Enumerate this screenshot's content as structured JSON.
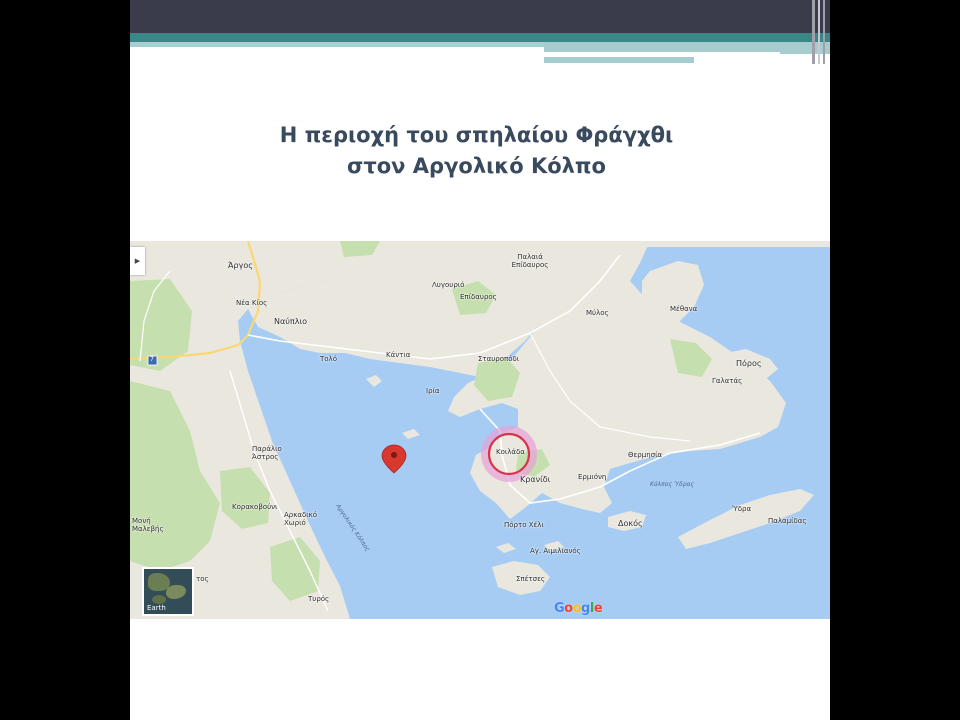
{
  "slide": {
    "title_line1": "Η περιοχή του σπηλαίου Φράγχθι",
    "title_line2": "στον Αργολικό Κόλπο"
  },
  "map": {
    "colors": {
      "water": "#a7ccf4",
      "land": "#eae7df",
      "green": "#c6dfae",
      "highlight_ring": "#d8324a",
      "highlight_glow": "#e7a0d8",
      "marker": "#d9382e"
    },
    "places": {
      "argos": "Άργος",
      "nea_kios": "Νέα Κίος",
      "nafplio": "Ναύπλιο",
      "tolo": "Τολό",
      "kantia": "Κάντια",
      "iria": "Ιρία",
      "paralio_astros": "Παράλιο Άστρος",
      "korakovouni": "Κορακοβούνι",
      "arkadiko_chorio": "Αρκαδικό Χωριό",
      "moni_malevis": "Μονή Μαλεβής",
      "tyros": "Τυρός",
      "ligourio": "Λυγουριό",
      "palaia_epidavros": "Παλαιά Επίδαυρος",
      "epidavros": "Επίδαυρος",
      "stavropodi": "Σταυροπόδι",
      "mylos": "Μύλος",
      "methana": "Μέθανα",
      "poros": "Πόρος",
      "galatas": "Γαλατάς",
      "koilada": "Κοιλάδα",
      "kranidi": "Κρανίδι",
      "ermioni": "Ερμιόνη",
      "thermisia": "Θερμησία",
      "porto_cheli": "Πόρτο Χέλι",
      "ag_aimilianos": "Αγ. Αιμιλιανός",
      "spetses": "Σπέτσες",
      "dokos": "Δοκός",
      "ydra": "Ύδρα",
      "palamidas": "Παλαμίδας",
      "argolikos_kolpos": "Αργολικός Κόλπος",
      "kolpos_ydras": "Κόλπος Ύδρας",
      "astros_short": "τος"
    },
    "earth_button": {
      "label": "Earth"
    },
    "google_logo": [
      "G",
      "o",
      "o",
      "g",
      "l",
      "e"
    ],
    "google_logo_colors": [
      "#4285f4",
      "#ea4335",
      "#fbbc05",
      "#4285f4",
      "#34a853",
      "#ea4335"
    ],
    "road_badge": "7"
  }
}
